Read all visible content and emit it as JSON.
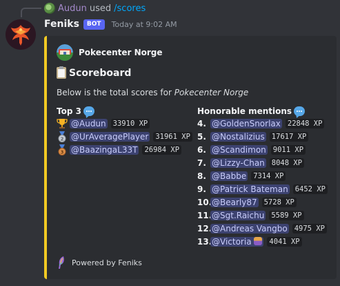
{
  "reply": {
    "user": "Audun",
    "used": "used",
    "command": "/scores"
  },
  "message": {
    "bot_name": "Feniks",
    "bot_tag": "BOT",
    "timestamp": "Today at 9:02 AM"
  },
  "embed": {
    "accent_color": "#f2ca23",
    "author": "Pokecenter Norge",
    "title": "Scoreboard",
    "description_prefix": "Below is the total scores for ",
    "description_emph": "Pokecenter Norge",
    "top3": {
      "name": "Top 3",
      "entries": [
        {
          "medal": "trophy-icon",
          "mention": "@Audun",
          "xp": "33910 XP"
        },
        {
          "medal": "second-place-medal-icon",
          "mention": "@UrAveragePlayer",
          "xp": "31961 XP"
        },
        {
          "medal": "third-place-medal-icon",
          "mention": "@BaazingaL33T",
          "xp": "26984 XP"
        }
      ]
    },
    "honorable": {
      "name": "Honorable mentions",
      "entries": [
        {
          "rank": "4.",
          "mention": "@GoldenSnorlax",
          "xp": "22848 XP"
        },
        {
          "rank": "5.",
          "mention": "@Nostalizius",
          "xp": "17617 XP"
        },
        {
          "rank": "6.",
          "mention": "@Scandimon",
          "xp": "9011 XP"
        },
        {
          "rank": "7.",
          "mention": "@Lizzy-Chan",
          "xp": "8048 XP"
        },
        {
          "rank": "8.",
          "mention": "@Babbe",
          "xp": "7314 XP"
        },
        {
          "rank": "9.",
          "mention": "@Patrick Bateman",
          "xp": "6452 XP"
        },
        {
          "rank": "10.",
          "mention": "@Bearly87",
          "xp": "5728 XP"
        },
        {
          "rank": "11.",
          "mention": "@Sgt.Raichu",
          "xp": "5589 XP"
        },
        {
          "rank": "12.",
          "mention": "@Andreas Vangbo",
          "xp": "4975 XP"
        },
        {
          "rank": "13.",
          "mention": "@Victoria",
          "xp": "4041 XP"
        }
      ]
    },
    "footer": "Powered by Feniks"
  }
}
